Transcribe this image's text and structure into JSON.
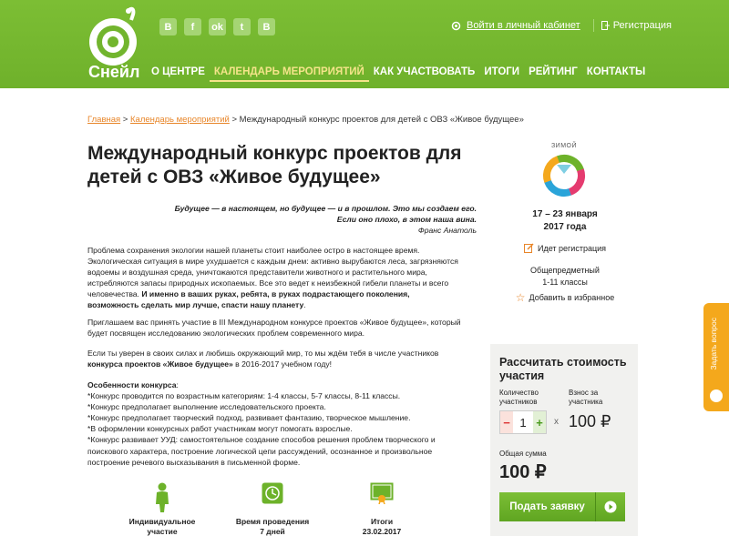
{
  "header": {
    "logo_text": "Снейл",
    "socials": [
      {
        "name": "vk",
        "glyph": "B"
      },
      {
        "name": "facebook",
        "glyph": "f"
      },
      {
        "name": "odnoklassniki",
        "glyph": "ok"
      },
      {
        "name": "twitter",
        "glyph": "t"
      },
      {
        "name": "blogger",
        "glyph": "B"
      }
    ],
    "login_label": "Войти в личный кабинет",
    "register_label": "Регистрация",
    "nav": [
      {
        "label": "О ЦЕНТРЕ",
        "active": false
      },
      {
        "label": "КАЛЕНДАРЬ МЕРОПРИЯТИЙ",
        "active": true
      },
      {
        "label": "КАК УЧАСТВОВАТЬ",
        "active": false
      },
      {
        "label": "ИТОГИ",
        "active": false
      },
      {
        "label": "РЕЙТИНГ",
        "active": false
      },
      {
        "label": "КОНТАКТЫ",
        "active": false
      }
    ],
    "colors": {
      "bg": "#72b52e",
      "active": "#f4e48a"
    }
  },
  "breadcrumb": {
    "home": "Главная",
    "sep": " > ",
    "calendar": "Календарь мероприятий",
    "current": "Международный конкурс проектов для детей с ОВЗ «Живое будущее»"
  },
  "title": "Международный конкурс проектов для детей с ОВЗ «Живое будущее»",
  "quote": {
    "line1": "Будущее — в настоящем, но будущее — и в прошлом. Это мы создаем его.",
    "line2": "Если оно плохо, в этом наша вина.",
    "author": "Франс Анатоль"
  },
  "body": {
    "p1_a": "Проблема сохранения экологии нашей планеты стоит наиболее остро в настоящее время. Экологическая ситуация в мире ухудшается с каждым днем: активно вырубаются леса, загрязняются водоемы и воздушная среда, уничтожаются представители животного и растительного мира, истребляются запасы природных ископаемых. Все это ведет к неизбежной гибели планеты и всего человечества.",
    "p1_b": "И именно в ваших руках, ребята, в руках подрастающего поколения, возможность сделать мир лучше, спасти нашу планету",
    "p2": "Приглашаем вас принять участие в III Международном конкурсе проектов «Живое будущее», который будет посвящен исследованию экологических проблем современного мира.",
    "p3_a": "Если ты уверен в своих силах и любишь окружающий мир, то мы ждём тебя в числе участников",
    "p3_b": "конкурса проектов «Живое будущее»",
    "p3_c": " в 2016-2017 учебном году!",
    "features_title": "Особенности конкурса",
    "features": [
      "*Конкурс проводится по возрастным категориям: 1-4 классы, 5-7 классы, 8-11 классы.",
      "*Конкурс предполагает выполнение исследовательского проекта.",
      "*Конкурс предполагает творческий подход, развивает фантазию, творческое мышление.",
      "*В оформлении конкурсных работ участникам могут помогать взрослые.",
      "*Конкурс развивает УУД: самостоятельное создание способов решения проблем творческого и поискового характера, построение логической цепи рассуждений, осознанное и произвольное построение речевого высказывания в письменной форме."
    ]
  },
  "event": {
    "season": "ЗИМОЙ",
    "dates_line1": "17 – 23 января",
    "dates_line2": "2017 года",
    "status": "Идет регистрация",
    "subject": "Общепредметный",
    "grades": "1-11 классы",
    "favorite": "Добавить в избранное"
  },
  "calc": {
    "title": "Рассчитать стоимость участия",
    "qty_label_1": "Количество",
    "qty_label_2": "участников",
    "fee_label_1": "Взнос за",
    "fee_label_2": "участника",
    "qty": "1",
    "times": "x",
    "fee": "100 ₽",
    "total_label": "Общая сумма",
    "total": "100 ₽",
    "apply_label": "Подать заявку",
    "colors": {
      "apply": "#6db22a"
    }
  },
  "features_bottom": [
    {
      "line1": "Индивидуальное",
      "line2": "участие",
      "icon": "person-icon"
    },
    {
      "line1": "Время проведения",
      "line2": "7 дней",
      "icon": "clock-icon"
    },
    {
      "line1": "Итоги",
      "line2": "23.02.2017",
      "icon": "certificate-icon"
    }
  ],
  "side_tab": {
    "label": "Задать вопрос"
  }
}
